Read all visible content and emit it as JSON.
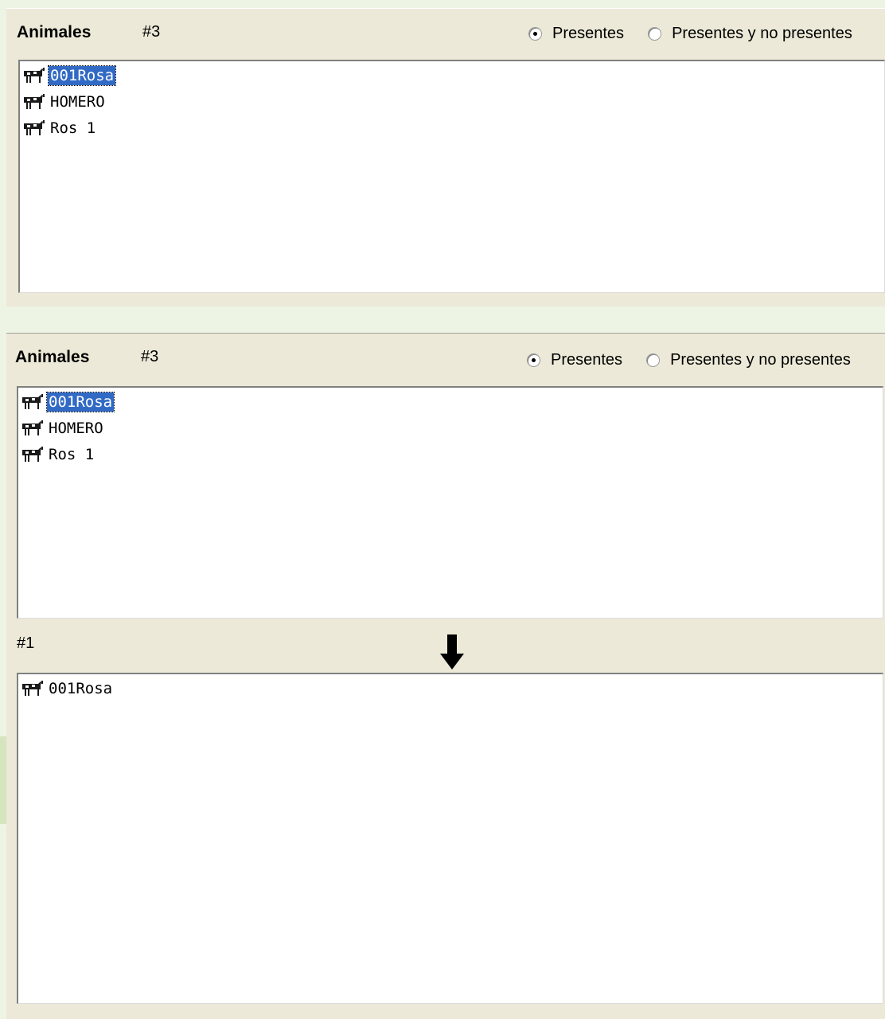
{
  "panel_top": {
    "title": "Animales",
    "count": "#3",
    "radio_present": "Presentes",
    "radio_all": "Presentes y no presentes",
    "radio_selected": "present",
    "items": [
      "001Rosa",
      "HOMERO",
      "Ros 1"
    ],
    "selected_item": "001Rosa"
  },
  "panel_bottom": {
    "title": "Animales",
    "count": "#3",
    "radio_present": "Presentes",
    "radio_all": "Presentes y no presentes",
    "radio_selected": "present",
    "items": [
      "001Rosa",
      "HOMERO",
      "Ros 1"
    ],
    "selected_item": "001Rosa",
    "result_count": "#1",
    "result_items": [
      "001Rosa"
    ]
  },
  "icons": {
    "animal": "cow-icon",
    "move_down": "arrow-down-icon"
  },
  "colors": {
    "selection": "#316ac5",
    "panel": "#ece9d8",
    "page": "#eef4e3"
  }
}
